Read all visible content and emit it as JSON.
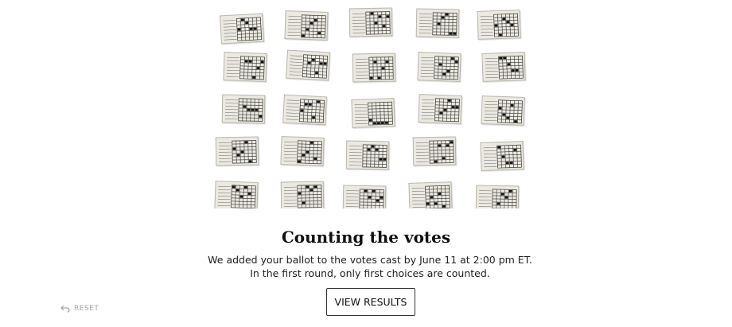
{
  "ballot_icon": "paper-ballot-icon",
  "section": {
    "title": "Counting the votes",
    "description": "We added your ballot to the votes cast by June 11 at 2:00 pm ET. In the first round, only first choices are counted."
  },
  "actions": {
    "view_results_label": "VIEW RESULTS",
    "reset_label": "RESET",
    "reset_icon": "undo-arrow-icon"
  },
  "colors": {
    "paper": "#ebe9e0",
    "mark": "#111111",
    "reset_text": "#a6a6a6"
  }
}
